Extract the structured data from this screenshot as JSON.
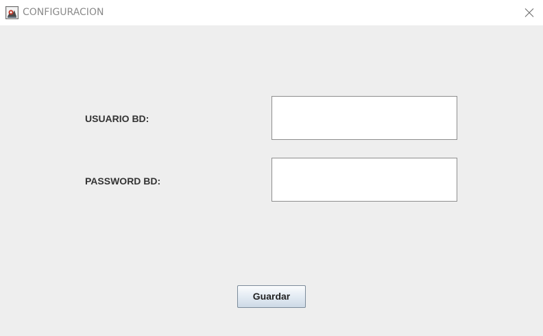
{
  "window": {
    "title": "CONFIGURACION",
    "app_icon": "java-app-icon",
    "close_icon": "close-icon"
  },
  "form": {
    "user_label": "USUARIO BD:",
    "user_value": "",
    "password_label": "PASSWORD BD:",
    "password_value": ""
  },
  "actions": {
    "save_label": "Guardar"
  },
  "colors": {
    "background": "#eeeeee",
    "titlebar": "#ffffff",
    "title_text": "#8a8a8a",
    "label_text": "#333333",
    "field_border": "#8c8c8c",
    "button_border": "#7a8a99"
  }
}
